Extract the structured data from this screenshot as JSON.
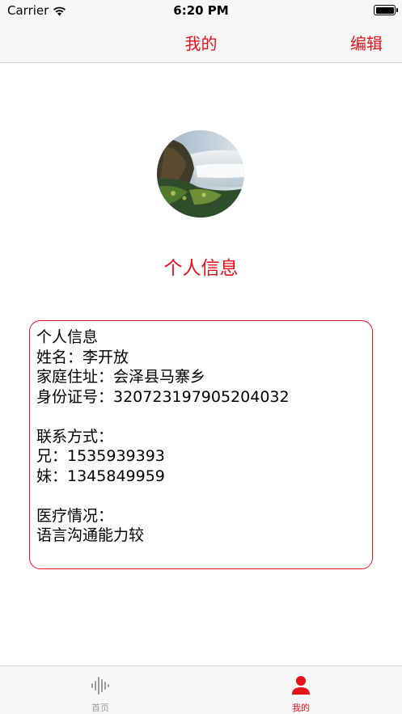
{
  "status_bar": {
    "carrier": "Carrier",
    "time": "6:20 PM",
    "wifi_icon": "wifi-icon",
    "battery_icon": "battery-icon"
  },
  "nav": {
    "title": "我的",
    "edit_label": "编辑"
  },
  "profile": {
    "avatar": "avatar-waterfall-image",
    "section_title": "个人信息"
  },
  "info": {
    "lines": [
      "个人信息",
      "姓名：李开放",
      "家庭住址：会泽县马寨乡",
      "身份证号：320723197905204032",
      "",
      "联系方式：",
      "兄：1535939393",
      "妹：1345849959",
      "",
      "医疗情况：",
      "语言沟通能力较"
    ]
  },
  "tabs": [
    {
      "label": "首页",
      "icon": "audio-wave-icon",
      "selected": false
    },
    {
      "label": "我的",
      "icon": "person-icon",
      "selected": true
    }
  ],
  "colors": {
    "accent": "#e8121d",
    "inactive": "#9a9a9a",
    "bar_background": "#f7f7f7"
  }
}
